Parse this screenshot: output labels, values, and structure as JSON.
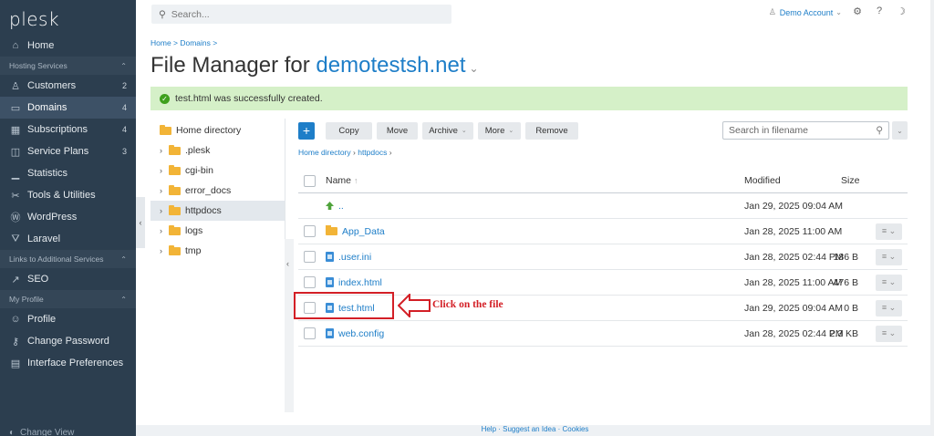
{
  "app": {
    "logo": "plesk"
  },
  "sidebar": {
    "items": [
      {
        "type": "item",
        "icon": "home-icon",
        "glyph": "⌂",
        "label": "Home",
        "count": ""
      },
      {
        "type": "section",
        "label": "Hosting Services"
      },
      {
        "type": "item",
        "icon": "user-icon",
        "glyph": "♙",
        "label": "Customers",
        "count": "2"
      },
      {
        "type": "item",
        "icon": "monitor-icon",
        "glyph": "▭",
        "label": "Domains",
        "count": "4",
        "active": true
      },
      {
        "type": "item",
        "icon": "grid-icon",
        "glyph": "▦",
        "label": "Subscriptions",
        "count": "4"
      },
      {
        "type": "item",
        "icon": "columns-icon",
        "glyph": "◫",
        "label": "Service Plans",
        "count": "3"
      },
      {
        "type": "item",
        "icon": "bar-chart-icon",
        "glyph": "▁",
        "label": "Statistics",
        "count": ""
      },
      {
        "type": "item",
        "icon": "tools-icon",
        "glyph": "✂",
        "label": "Tools & Utilities",
        "count": ""
      },
      {
        "type": "item",
        "icon": "wordpress-icon",
        "glyph": "Ⓦ",
        "label": "WordPress",
        "count": ""
      },
      {
        "type": "item",
        "icon": "laravel-icon",
        "glyph": "⛛",
        "label": "Laravel",
        "count": ""
      },
      {
        "type": "section",
        "label": "Links to Additional Services"
      },
      {
        "type": "item",
        "icon": "seo-icon",
        "glyph": "↗",
        "label": "SEO",
        "count": ""
      },
      {
        "type": "section",
        "label": "My Profile"
      },
      {
        "type": "item",
        "icon": "profile-icon",
        "glyph": "☺",
        "label": "Profile",
        "count": ""
      },
      {
        "type": "item",
        "icon": "key-icon",
        "glyph": "⚷",
        "label": "Change Password",
        "count": ""
      },
      {
        "type": "item",
        "icon": "preferences-icon",
        "glyph": "▤",
        "label": "Interface Preferences",
        "count": ""
      }
    ],
    "bottom_label": "Change View"
  },
  "topbar": {
    "search_placeholder": "Search...",
    "account_label": "Demo Account"
  },
  "breadcrumb": "Home > Domains >",
  "title": {
    "prefix": "File Manager for ",
    "domain": "demotestsh.net"
  },
  "alert": "test.html was successfully created.",
  "tree": {
    "root": "Home directory",
    "children": [
      ".plesk",
      "cgi-bin",
      "error_docs",
      "httpdocs",
      "logs",
      "tmp"
    ],
    "active": "httpdocs"
  },
  "toolbar": {
    "copy": "Copy",
    "move": "Move",
    "archive": "Archive",
    "more": "More",
    "remove": "Remove",
    "search_placeholder": "Search in filename"
  },
  "path": {
    "root": "Home directory",
    "current": "httpdocs"
  },
  "table": {
    "headers": {
      "name": "Name",
      "modified": "Modified",
      "size": "Size"
    },
    "rows": [
      {
        "kind": "up",
        "name": "..",
        "modified": "Jan 29, 2025 09:04 AM",
        "size": "",
        "menu": false,
        "checkbox": false
      },
      {
        "kind": "folder",
        "name": "App_Data",
        "modified": "Jan 28, 2025 11:00 AM",
        "size": "",
        "menu": true,
        "checkbox": true
      },
      {
        "kind": "file",
        "name": ".user.ini",
        "modified": "Jan 28, 2025 02:44 PM",
        "size": "186 B",
        "menu": true,
        "checkbox": true
      },
      {
        "kind": "html",
        "name": "index.html",
        "modified": "Jan 28, 2025 11:00 AM",
        "size": "476 B",
        "menu": true,
        "checkbox": true
      },
      {
        "kind": "html",
        "name": "test.html",
        "modified": "Jan 29, 2025 09:04 AM",
        "size": "0 B",
        "menu": true,
        "checkbox": true
      },
      {
        "kind": "file",
        "name": "web.config",
        "modified": "Jan 28, 2025 02:44 PM",
        "size": "2.3 KB",
        "menu": true,
        "checkbox": true
      }
    ]
  },
  "annotation": {
    "text": "Click on the file",
    "color": "#d31f26"
  },
  "footer": "Help · Suggest an Idea · Cookies",
  "colors": {
    "sidebar_bg": "#2c3e4f",
    "accent": "#1e7ec8",
    "success_bg": "#d5f0c8",
    "highlight": "#d31f26"
  }
}
